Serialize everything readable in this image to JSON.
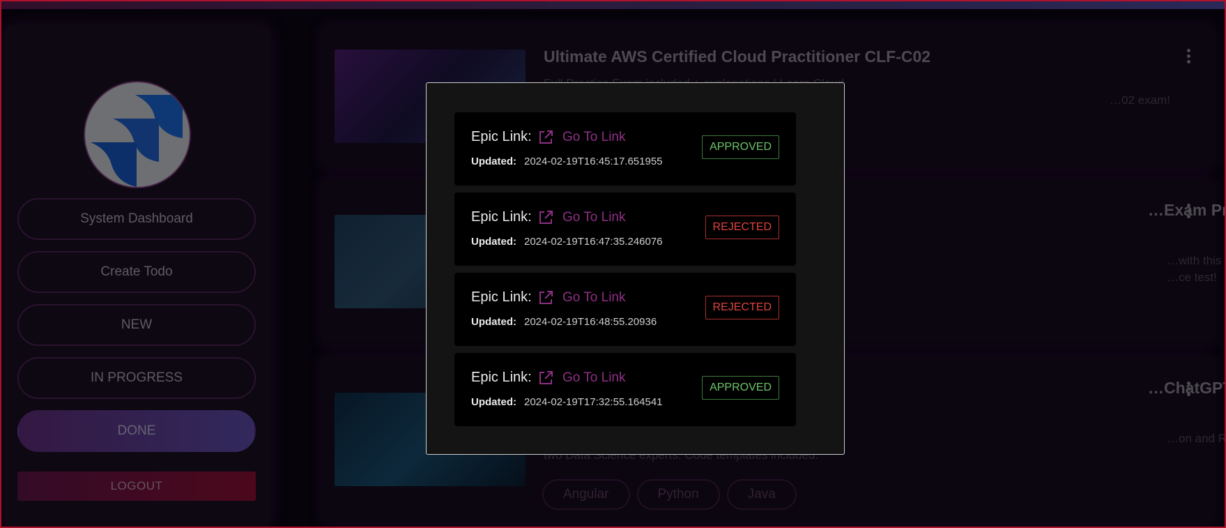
{
  "sidebar": {
    "nav": [
      "System Dashboard",
      "Create Todo",
      "NEW",
      "IN PROGRESS",
      "DONE"
    ],
    "logout": "LOGOUT"
  },
  "courses": [
    {
      "title": "Ultimate AWS Certified Cloud Practitioner CLF-C02",
      "desc": [
        "Full Practice Exam included + explanations | Learn Cloud",
        "…02 exam!"
      ]
    },
    {
      "title": "…Exam Prep -",
      "desc": [
        "…with this",
        "…ce test!"
      ]
    },
    {
      "title": "…ChatGPT",
      "desc": [
        "…on and R from",
        "two Data Science experts. Code templates included."
      ],
      "tags": [
        "Angular",
        "Python",
        "Java"
      ]
    }
  ],
  "modal": {
    "entries": [
      {
        "epic_label": "Epic Link:",
        "link_text": "Go To Link",
        "updated_label": "Updated:",
        "updated": "2024-02-19T16:45:17.651955",
        "status": "APPROVED"
      },
      {
        "epic_label": "Epic Link:",
        "link_text": "Go To Link",
        "updated_label": "Updated:",
        "updated": "2024-02-19T16:47:35.246076",
        "status": "REJECTED"
      },
      {
        "epic_label": "Epic Link:",
        "link_text": "Go To Link",
        "updated_label": "Updated:",
        "updated": "2024-02-19T16:48:55.20936",
        "status": "REJECTED"
      },
      {
        "epic_label": "Epic Link:",
        "link_text": "Go To Link",
        "updated_label": "Updated:",
        "updated": "2024-02-19T17:32:55.164541",
        "status": "APPROVED"
      }
    ]
  },
  "colors": {
    "accent": "#8e2f86",
    "approved": "#6ec56b",
    "rejected": "#e0433f",
    "background": "#0b0613"
  }
}
